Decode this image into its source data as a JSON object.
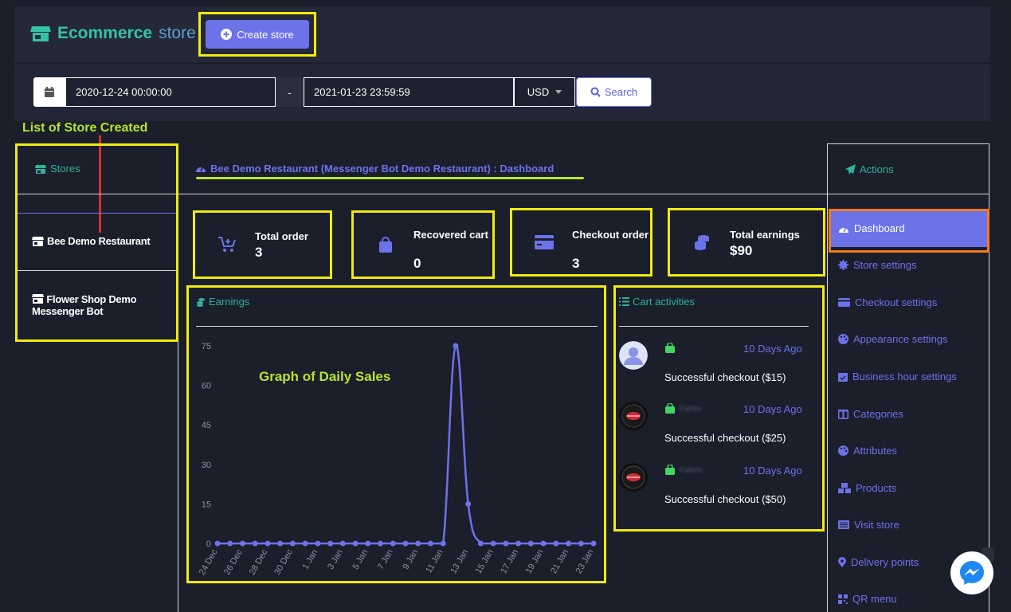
{
  "header": {
    "brand": "Ecommerce store",
    "brand_main": "Ecommerce",
    "brand_sub": "store",
    "create_button": "Create store"
  },
  "filters": {
    "date_from": "2020-12-24 00:00:00",
    "separator": "-",
    "date_to": "2021-01-23 23:59:59",
    "currency": "USD",
    "search_button": "Search"
  },
  "annotations": {
    "store_list": "List of Store Created",
    "graph": "Graph of Daily Sales"
  },
  "stores": {
    "title": "Stores",
    "items": [
      "Bee Demo Restaurant",
      "Flower Shop Demo Messenger Bot"
    ]
  },
  "dashboard": {
    "title": "Bee Demo Restaurant (Messenger Bot Demo Restaurant) : Dashboard"
  },
  "stats": [
    {
      "label": "Total order",
      "value": "3",
      "icon": "cart-plus-icon"
    },
    {
      "label": "Recovered cart",
      "value": "0",
      "icon": "shopping-bag-icon"
    },
    {
      "label": "Checkout order",
      "value": "3",
      "icon": "credit-card-icon"
    },
    {
      "label": "Total earnings",
      "value": "$90",
      "icon": "coins-icon"
    }
  ],
  "earnings": {
    "title": "Earnings"
  },
  "chart_data": {
    "type": "line",
    "title": "",
    "xlabel": "",
    "ylabel": "",
    "ylim": [
      0,
      75
    ],
    "yticks": [
      "0",
      "15",
      "30",
      "45",
      "60",
      "75"
    ],
    "x": [
      "24 Dec",
      "25 Dec",
      "26 Dec",
      "27 Dec",
      "28 Dec",
      "29 Dec",
      "30 Dec",
      "31 Dec",
      "1 Jan",
      "2 Jan",
      "3 Jan",
      "4 Jan",
      "5 Jan",
      "6 Jan",
      "7 Jan",
      "8 Jan",
      "9 Jan",
      "10 Jan",
      "11 Jan",
      "12 Jan",
      "13 Jan",
      "14 Jan",
      "15 Jan",
      "16 Jan",
      "17 Jan",
      "18 Jan",
      "19 Jan",
      "20 Jan",
      "21 Jan",
      "22 Jan",
      "23 Jan"
    ],
    "xtick_labels": [
      "24 Dec",
      "26 Dec",
      "28 Dec",
      "30 Dec",
      "1 Jan",
      "3 Jan",
      "5 Jan",
      "7 Jan",
      "9 Jan",
      "11 Jan",
      "13 Jan",
      "15 Jan",
      "17 Jan",
      "19 Jan",
      "21 Jan",
      "23 Jan"
    ],
    "series": [
      {
        "values": [
          0,
          0,
          0,
          0,
          0,
          0,
          0,
          0,
          0,
          0,
          0,
          0,
          0,
          0,
          0,
          0,
          0,
          0,
          0,
          75,
          15,
          0,
          0,
          0,
          0,
          0,
          0,
          0,
          0,
          0,
          0
        ]
      }
    ],
    "color": "#6c73e8",
    "grid": false
  },
  "cart_activities": {
    "title": "Cart activities",
    "items": [
      {
        "time": "10 Days Ago",
        "text": "Successful checkout ($15)",
        "name": ""
      },
      {
        "time": "10 Days Ago",
        "text": "Successful checkout ($25)",
        "name": "Fahim"
      },
      {
        "time": "10 Days Ago",
        "text": "Successful checkout ($50)",
        "name": "Fahim"
      }
    ]
  },
  "actions": {
    "title": "Actions",
    "items": [
      {
        "label": "Dashboard",
        "icon": "gauge-icon"
      },
      {
        "label": "Store settings",
        "icon": "gear-icon"
      },
      {
        "label": "Checkout settings",
        "icon": "credit-card-icon"
      },
      {
        "label": "Appearance settings",
        "icon": "palette-icon"
      },
      {
        "label": "Business hour settings",
        "icon": "calendar-check-icon"
      },
      {
        "label": "Categories",
        "icon": "columns-icon"
      },
      {
        "label": "Attributes",
        "icon": "palette-icon"
      },
      {
        "label": "Products",
        "icon": "cubes-icon"
      },
      {
        "label": "Visit store",
        "icon": "list-icon"
      },
      {
        "label": "Delivery points",
        "icon": "map-marker-icon"
      },
      {
        "label": "QR menu",
        "icon": "qrcode-icon"
      }
    ]
  },
  "colors": {
    "accent": "#6c73e8",
    "teal": "#2fb39a",
    "highlight": "#f2ea0f",
    "annotation": "#b6e630",
    "active_border": "#f47a20",
    "background": "#1b1e2b"
  }
}
